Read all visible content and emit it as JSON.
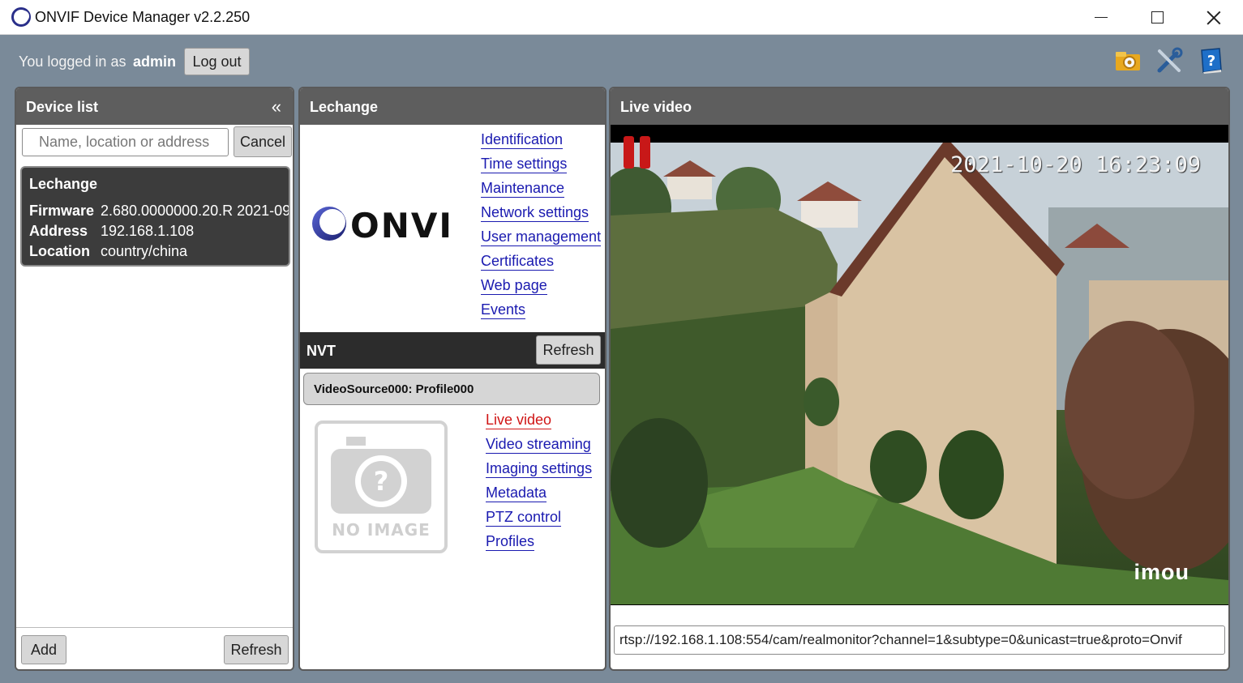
{
  "window": {
    "title": "ONVIF Device Manager v2.2.250",
    "minimize_icon": "minimize-icon",
    "maximize_icon": "maximize-icon",
    "close_icon": "close-icon"
  },
  "session": {
    "logged_in_label": "You logged in as",
    "username": "admin",
    "logout_label": "Log out"
  },
  "toolbar": {
    "icons": [
      "settings-folder-icon",
      "tools-icon",
      "help-book-icon"
    ]
  },
  "device_list": {
    "title": "Device list",
    "collapse_glyph": "«",
    "search_placeholder": "Name, location or address",
    "cancel_label": "Cancel",
    "device": {
      "name": "Lechange",
      "firmware_label": "Firmware",
      "firmware": "2.680.0000000.20.R 2021-09",
      "address_label": "Address",
      "address": "192.168.1.108",
      "location_label": "Location",
      "location": "country/china"
    },
    "add_label": "Add",
    "refresh_label": "Refresh"
  },
  "device_panel": {
    "title": "Lechange",
    "logo_text": "ONVIF",
    "links": [
      "Identification",
      "Time settings",
      "Maintenance",
      "Network settings",
      "User management",
      "Certificates",
      "Web page",
      "Events"
    ],
    "nvt_label": "NVT",
    "nvt_refresh_label": "Refresh",
    "profile_label": "VideoSource000: Profile000",
    "noimage_text": "NO IMAGE",
    "profile_links": [
      "Live video",
      "Video streaming",
      "Imaging settings",
      "Metadata",
      "PTZ control",
      "Profiles"
    ],
    "active_link": "Live video"
  },
  "live_video": {
    "title": "Live video",
    "timestamp": "2021-10-20 16:23:09",
    "watermark": "imou",
    "stream_url": "rtsp://192.168.1.108:554/cam/realmonitor?channel=1&subtype=0&unicast=true&proto=Onvif"
  },
  "colors": {
    "background": "#7a8a99",
    "header": "#5e5e5e",
    "link": "#1a1ab0",
    "active_link": "#d01515"
  }
}
